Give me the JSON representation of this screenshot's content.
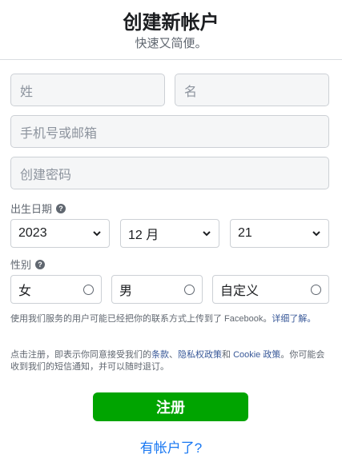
{
  "header": {
    "title": "创建新帐户",
    "subtitle": "快速又简便。"
  },
  "form": {
    "first_name_placeholder": "姓",
    "last_name_placeholder": "名",
    "contact_placeholder": "手机号或邮箱",
    "password_placeholder": "创建密码",
    "birthday_label": "出生日期",
    "birthday": {
      "year": "2023",
      "month": "12 月",
      "day": "21"
    },
    "gender_label": "性别",
    "gender_options": [
      "女",
      "男",
      "自定义"
    ],
    "help_icon": "question-circle-icon"
  },
  "notes": {
    "contact_upload_text": "使用我们服务的用户可能已经把你的联系方式上传到了 Facebook。",
    "learn_more": "详细了解。",
    "terms_prefix": "点击注册，即表示你同意接受我们的",
    "terms_link": "条款",
    "terms_sep": "、",
    "privacy_link": "隐私权政策",
    "and": "和 ",
    "cookie_link": "Cookie 政策",
    "terms_suffix": "。你可能会收到我们的短信通知，并可以随时退订。"
  },
  "actions": {
    "signup_label": "注册",
    "have_account_label": "有帐户了?"
  },
  "colors": {
    "signup_green": "#00a400",
    "link_blue": "#1877f2",
    "text_gray": "#606770"
  }
}
